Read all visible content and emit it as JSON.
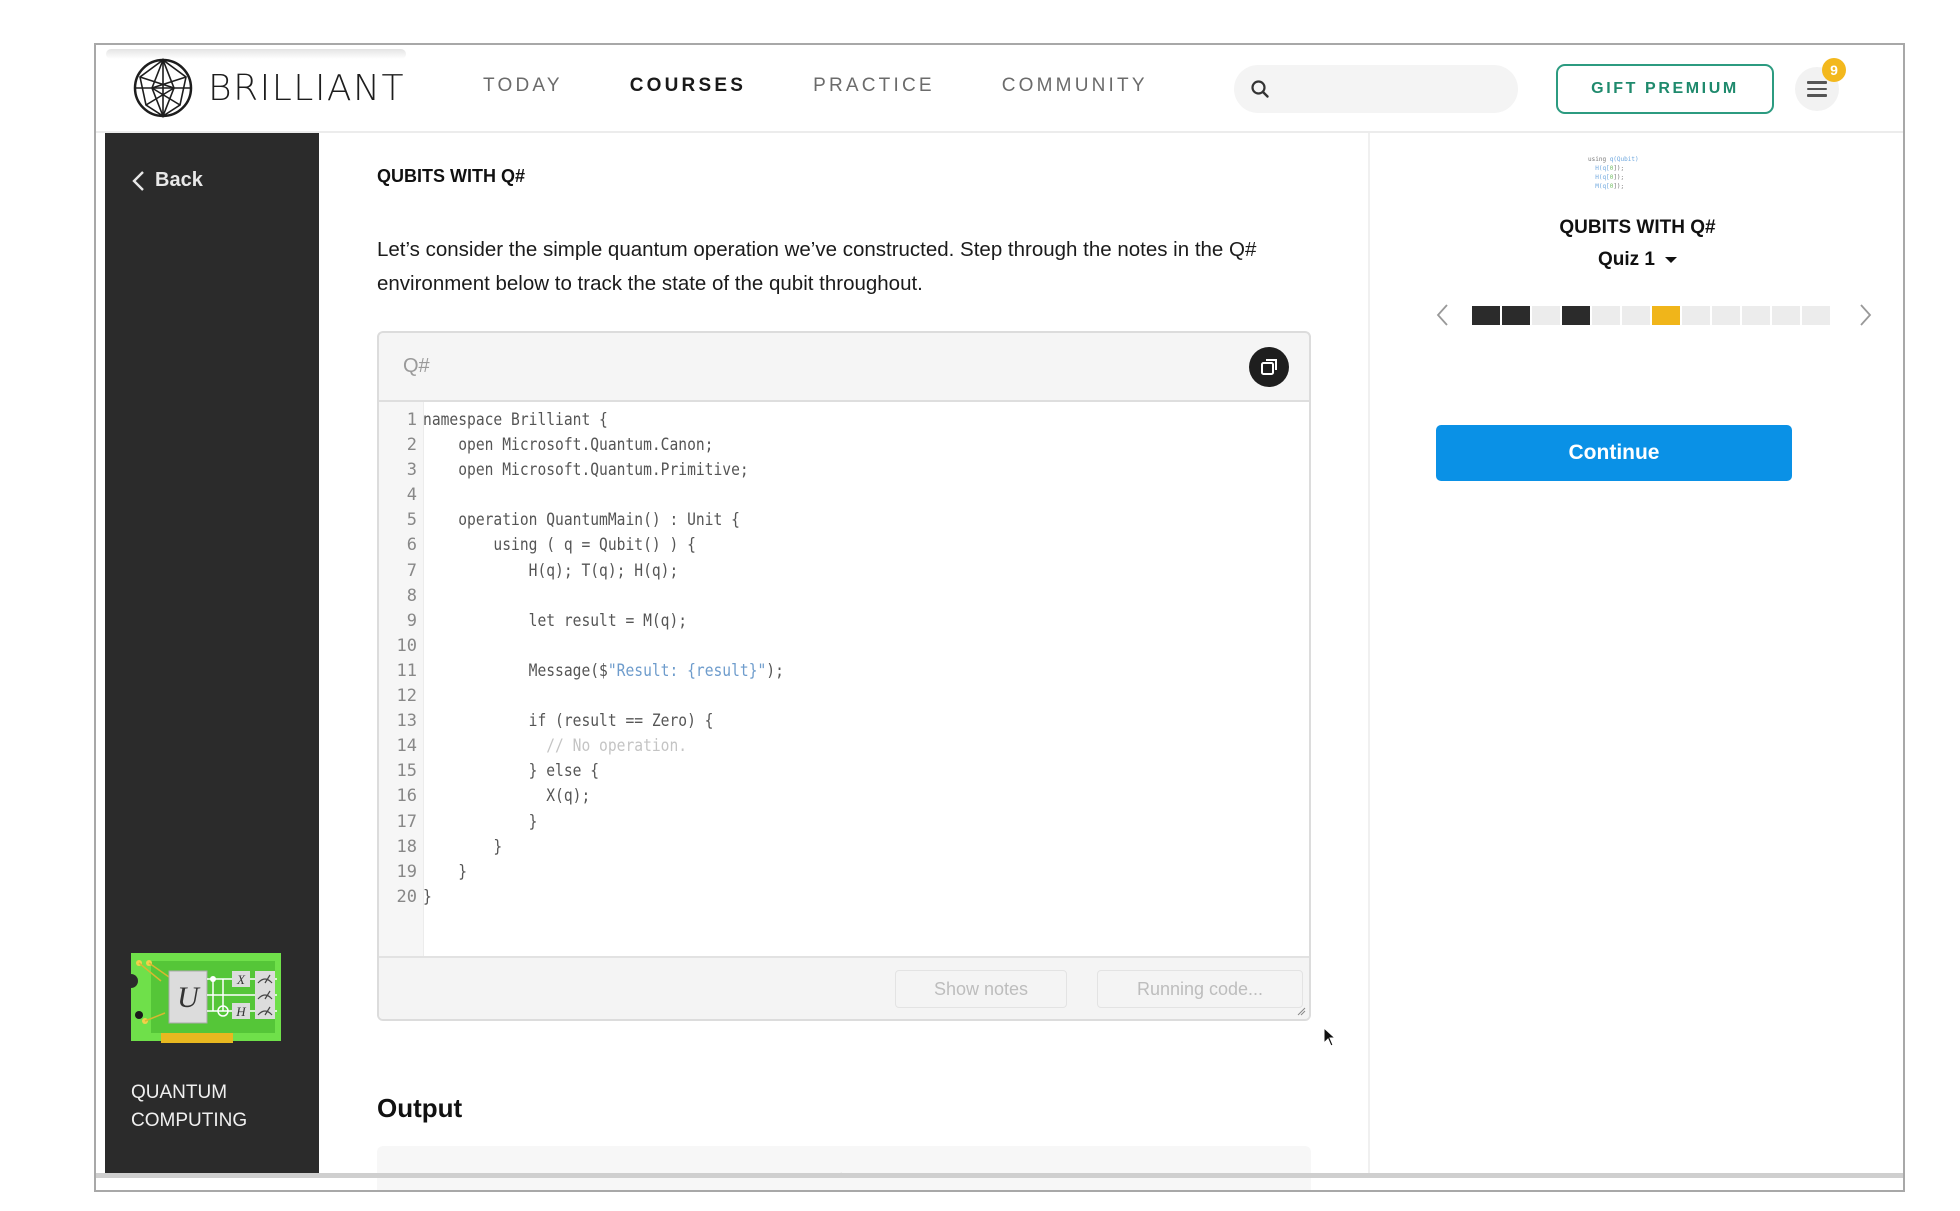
{
  "header": {
    "brand": "BRILLIANT",
    "nav": [
      {
        "label": "TODAY",
        "active": false
      },
      {
        "label": "COURSES",
        "active": true
      },
      {
        "label": "PRACTICE",
        "active": false
      },
      {
        "label": "COMMUNITY",
        "active": false
      }
    ],
    "search": {
      "placeholder": "",
      "value": ""
    },
    "gift_label": "GIFT PREMIUM",
    "menu_badge": "9"
  },
  "sidebar": {
    "back_label": "Back",
    "course_name_line1": "QUANTUM",
    "course_name_line2": "COMPUTING",
    "course_art_labels": {
      "u": "U",
      "x": "X",
      "h": "H"
    }
  },
  "main": {
    "kicker": "QUBITS WITH Q#",
    "intro": "Let’s consider the simple quantum operation we’ve constructed. Step through the notes in the Q# environment below to track the state of the qubit throughout.",
    "editor": {
      "language": "Q#",
      "lines": [
        {
          "n": "1",
          "parts": [
            {
              "t": "namespace Brilliant {",
              "c": ""
            }
          ]
        },
        {
          "n": "2",
          "parts": [
            {
              "t": "    open Microsoft.Quantum.Canon;",
              "c": ""
            }
          ]
        },
        {
          "n": "3",
          "parts": [
            {
              "t": "    open Microsoft.Quantum.Primitive;",
              "c": ""
            }
          ]
        },
        {
          "n": "4",
          "parts": [
            {
              "t": "",
              "c": ""
            }
          ]
        },
        {
          "n": "5",
          "parts": [
            {
              "t": "    operation QuantumMain() : Unit {",
              "c": ""
            }
          ]
        },
        {
          "n": "6",
          "parts": [
            {
              "t": "        using ( q = Qubit() ) {",
              "c": ""
            }
          ]
        },
        {
          "n": "7",
          "parts": [
            {
              "t": "            H(q); T(q); H(q);",
              "c": ""
            }
          ]
        },
        {
          "n": "8",
          "parts": [
            {
              "t": "",
              "c": ""
            }
          ]
        },
        {
          "n": "9",
          "parts": [
            {
              "t": "            let result = M(q);",
              "c": ""
            }
          ]
        },
        {
          "n": "10",
          "parts": [
            {
              "t": "",
              "c": ""
            }
          ]
        },
        {
          "n": "11",
          "parts": [
            {
              "t": "            Message($",
              "c": ""
            },
            {
              "t": "\"Result: {result}\"",
              "c": "str"
            },
            {
              "t": ");",
              "c": ""
            }
          ]
        },
        {
          "n": "12",
          "parts": [
            {
              "t": "",
              "c": ""
            }
          ]
        },
        {
          "n": "13",
          "parts": [
            {
              "t": "            if (result == Zero) {",
              "c": ""
            }
          ]
        },
        {
          "n": "14",
          "parts": [
            {
              "t": "              // No operation.",
              "c": "cmt"
            }
          ]
        },
        {
          "n": "15",
          "parts": [
            {
              "t": "            } else {",
              "c": ""
            }
          ]
        },
        {
          "n": "16",
          "parts": [
            {
              "t": "              X(q);",
              "c": ""
            }
          ]
        },
        {
          "n": "17",
          "parts": [
            {
              "t": "            }",
              "c": ""
            }
          ]
        },
        {
          "n": "18",
          "parts": [
            {
              "t": "        }",
              "c": ""
            }
          ]
        },
        {
          "n": "19",
          "parts": [
            {
              "t": "    }",
              "c": ""
            }
          ]
        },
        {
          "n": "20",
          "parts": [
            {
              "t": "}",
              "c": ""
            }
          ]
        }
      ],
      "show_notes_label": "Show notes",
      "run_label": "Running code..."
    },
    "output_title": "Output"
  },
  "right_panel": {
    "thumbnail_lines": [
      [
        {
          "t": "using ",
          "c": ""
        },
        {
          "t": "q(Qubit)",
          "c": "b"
        }
      ],
      [
        {
          "t": "  H(q[",
          "c": "b"
        },
        {
          "t": "0",
          "c": "g"
        },
        {
          "t": "]);",
          "c": ""
        }
      ],
      [
        {
          "t": "  H(q[",
          "c": "b"
        },
        {
          "t": "0",
          "c": "g"
        },
        {
          "t": "]);",
          "c": ""
        }
      ],
      [
        {
          "t": "  M(q[",
          "c": "b"
        },
        {
          "t": "0",
          "c": "g"
        },
        {
          "t": "]);",
          "c": ""
        }
      ]
    ],
    "title": "QUBITS WITH Q#",
    "quiz_label": "Quiz 1",
    "progress": [
      "done",
      "done",
      "todo",
      "done",
      "todo",
      "todo",
      "current",
      "todo",
      "todo",
      "todo",
      "todo",
      "todo"
    ],
    "continue_label": "Continue"
  },
  "colors": {
    "brand_green": "#2c9b80",
    "badge_yellow": "#f3b81d",
    "continue_blue": "#0a91e6",
    "progress_current": "#f0b51a",
    "progress_done": "#2b2b2b",
    "sidebar_bg": "#2b2b2b"
  }
}
